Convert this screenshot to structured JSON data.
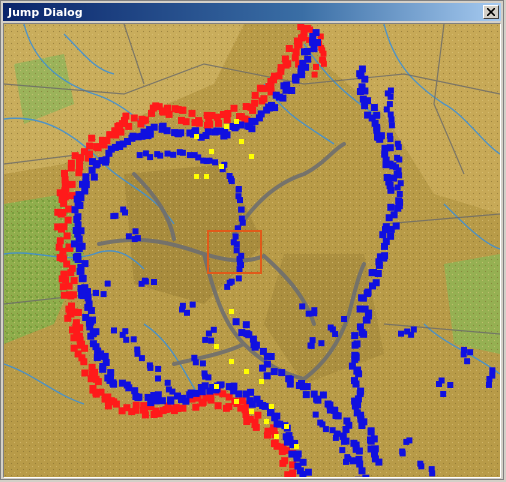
{
  "window": {
    "title": "Jump Dialog",
    "close_icon": "close-icon"
  },
  "map": {
    "description_icons": {
      "front_red": "red-unit-marker",
      "front_blue": "blue-unit-marker",
      "yellow_units": "yellow-unit-marker",
      "selection": "viewport-selection-rect"
    },
    "colors": {
      "terrain_base": "#b89b48",
      "terrain_light": "#d6b86a",
      "terrain_green": "#8fae4c",
      "river": "#3c8fd8",
      "road": "#6f6f6f",
      "red": "#ff1a1a",
      "blue": "#1010e0",
      "yellow": "#ffff00",
      "selection": "#e05a1a"
    }
  }
}
